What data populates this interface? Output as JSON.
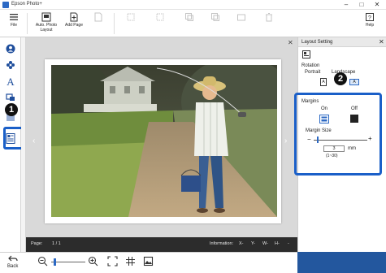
{
  "window": {
    "title": "Epson Photo+"
  },
  "toolbar": {
    "file": "File",
    "auto_layout": "Auto. Photo Layout",
    "add_page": "Add Page",
    "help": "Help"
  },
  "status": {
    "page_label": "Page:",
    "page_value": "1 / 1",
    "info_label": "Information:",
    "x": "X-",
    "y": "Y-",
    "w": "W-",
    "h": "H-",
    "dash": "-"
  },
  "bottom": {
    "back": "Back"
  },
  "panel": {
    "title": "Layout Setting",
    "rotation": "Rotation",
    "portrait": "Portrait",
    "landscape": "Landscape",
    "margins": "Margins",
    "on": "On",
    "off": "Off",
    "margin_size": "Margin Size",
    "size_value": "3",
    "unit": "mm",
    "range": "(1~30)"
  },
  "callouts": {
    "one": "1",
    "two": "2"
  },
  "colors": {
    "accent": "#1a5fc8",
    "panel_strip": "#23579e",
    "status_bg": "#2c2c2c"
  }
}
